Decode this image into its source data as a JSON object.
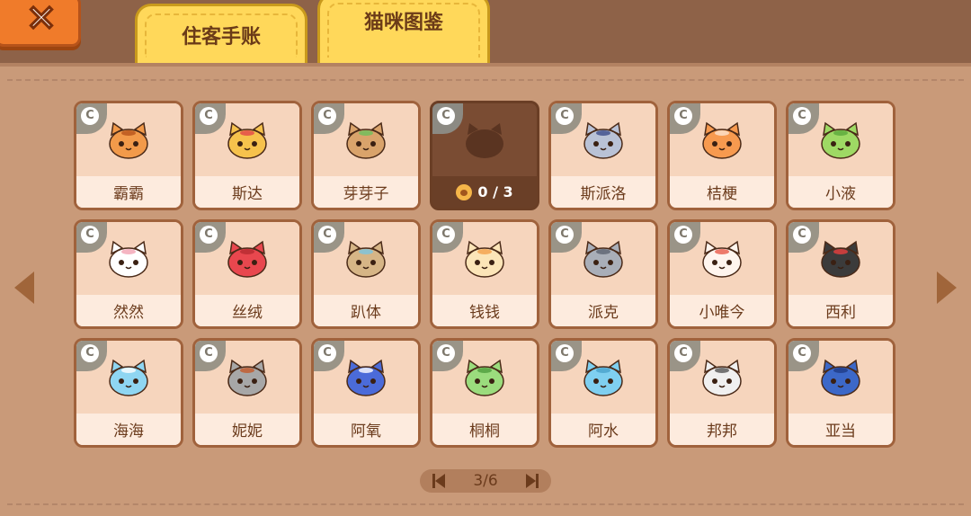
{
  "tabs": [
    {
      "label": "住客手账",
      "active": false
    },
    {
      "label": "猫咪图鉴",
      "active": true
    }
  ],
  "close_icon": "close-icon",
  "pager": {
    "text": "3/6"
  },
  "cats": [
    {
      "name": "霸霸",
      "rarity": "C",
      "color": "#f29a4a",
      "accent": "#b5521a",
      "locked": false
    },
    {
      "name": "斯达",
      "rarity": "C",
      "color": "#f6c24c",
      "accent": "#e2454a",
      "locked": false
    },
    {
      "name": "芽芽子",
      "rarity": "C",
      "color": "#d9a36b",
      "accent": "#6bbf5b",
      "locked": false
    },
    {
      "name": "",
      "rarity": "C",
      "color": "#5a3421",
      "accent": "#5a3421",
      "locked": true,
      "progress": "0 / 3"
    },
    {
      "name": "斯派洛",
      "rarity": "C",
      "color": "#b9c2d6",
      "accent": "#3b4b8a",
      "locked": false
    },
    {
      "name": "桔梗",
      "rarity": "C",
      "color": "#f79a4f",
      "accent": "#fbe3cf",
      "locked": false
    },
    {
      "name": "小液",
      "rarity": "C",
      "color": "#9ed964",
      "accent": "#5aa83b",
      "locked": false
    },
    {
      "name": "然然",
      "rarity": "C",
      "color": "#ffffff",
      "accent": "#f2a3b3",
      "locked": false
    },
    {
      "name": "丝绒",
      "rarity": "C",
      "color": "#e8474e",
      "accent": "#b52a31",
      "locked": false
    },
    {
      "name": "趴体",
      "rarity": "C",
      "color": "#d6b586",
      "accent": "#7bc6e0",
      "locked": false
    },
    {
      "name": "钱钱",
      "rarity": "C",
      "color": "#fce5b8",
      "accent": "#f2a04a",
      "locked": false
    },
    {
      "name": "派克",
      "rarity": "C",
      "color": "#a9aeb8",
      "accent": "#5d6371",
      "locked": false
    },
    {
      "name": "小唯今",
      "rarity": "C",
      "color": "#fff5ee",
      "accent": "#e85b4a",
      "locked": false
    },
    {
      "name": "西利",
      "rarity": "C",
      "color": "#3b3b3b",
      "accent": "#e8403f",
      "locked": false
    },
    {
      "name": "海海",
      "rarity": "C",
      "color": "#8fd6f2",
      "accent": "#ffffff",
      "locked": false
    },
    {
      "name": "妮妮",
      "rarity": "C",
      "color": "#a7a7a7",
      "accent": "#c45a2a",
      "locked": false
    },
    {
      "name": "阿氧",
      "rarity": "C",
      "color": "#4b6bd9",
      "accent": "#ffffff",
      "locked": false
    },
    {
      "name": "桐桐",
      "rarity": "C",
      "color": "#9bdc7d",
      "accent": "#4f9e3c",
      "locked": false
    },
    {
      "name": "阿水",
      "rarity": "C",
      "color": "#7fcff0",
      "accent": "#4aa1cc",
      "locked": false
    },
    {
      "name": "邦邦",
      "rarity": "C",
      "color": "#f0f0f0",
      "accent": "#555555",
      "locked": false
    },
    {
      "name": "亚当",
      "rarity": "C",
      "color": "#3c68c8",
      "accent": "#1f3b86",
      "locked": false
    }
  ]
}
